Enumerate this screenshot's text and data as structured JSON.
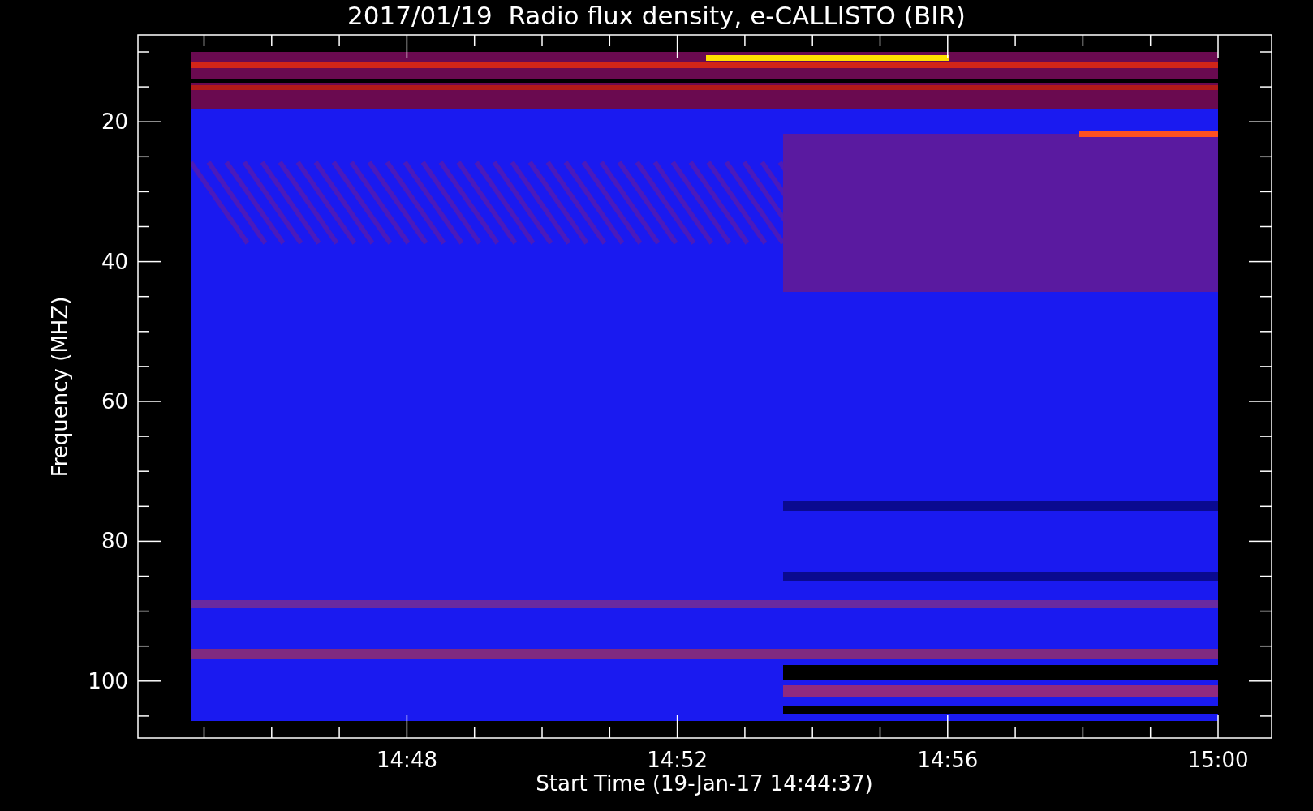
{
  "title": "2017/01/19  Radio flux density, e-CALLISTO (BIR)",
  "y_axis": {
    "label": "Frequency (MHZ)",
    "ticks": [
      "20",
      "40",
      "60",
      "80",
      "100"
    ]
  },
  "x_axis": {
    "label": "Start Time (19-Jan-17 14:44:37)",
    "ticks": [
      "14:48",
      "14:52",
      "14:56",
      "15:00"
    ]
  }
}
